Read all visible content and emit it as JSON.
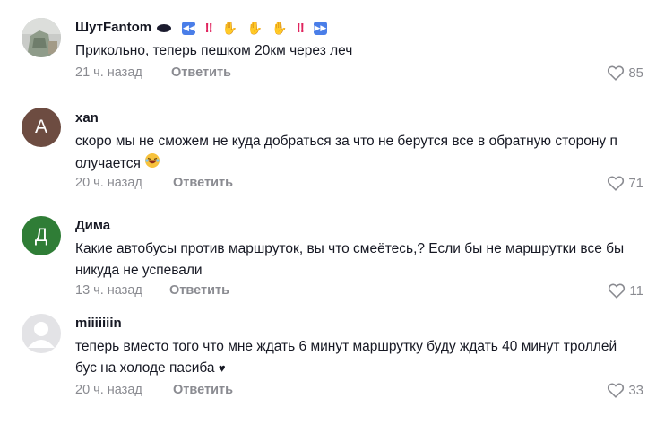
{
  "comments": [
    {
      "username": "ШутFantom",
      "text": "Прикольно, теперь пешком 20км через леч",
      "time": "21 ч. назад",
      "reply": "Ответить",
      "likes": "85",
      "avatar": "photo",
      "name_emojis": [
        "black-oval-icon",
        "rewind-icon",
        "double-exclamation-icon",
        "praying-hands-icon",
        "praying-hands-icon",
        "praying-hands-icon",
        "double-exclamation-icon",
        "fast-forward-icon"
      ]
    },
    {
      "username": "xan",
      "text_line1": "скоро мы не сможем не куда добраться за что не берутся все в обратную сторону п",
      "text_line2": "олучается",
      "text_emoji": "laughing-face-icon",
      "time": "20 ч. назад",
      "reply": "Ответить",
      "likes": "71",
      "avatar_letter": "A"
    },
    {
      "username": "Дима",
      "text_line1": "Какие автобусы против маршруток, вы что смеётесь,? Если бы не маршрутки все бы",
      "text_line2": "никуда не успевали",
      "time": "13 ч. назад",
      "reply": "Ответить",
      "likes": "11",
      "avatar_letter": "Д"
    },
    {
      "username": "miiiiiiin",
      "text_line1": "теперь вместо того что мне ждать 6 минут маршрутку буду ждать 40 минут троллей",
      "text_line2": "бус на холоде пасиба",
      "text_emoji": "black-heart-icon",
      "time": "20 ч. назад",
      "reply": "Ответить",
      "likes": "33",
      "avatar": "default"
    }
  ],
  "colors": {
    "text": "#161823",
    "meta": "#8a8b91",
    "avatar_a": "#6d4c41",
    "avatar_d": "#2f7d36"
  }
}
